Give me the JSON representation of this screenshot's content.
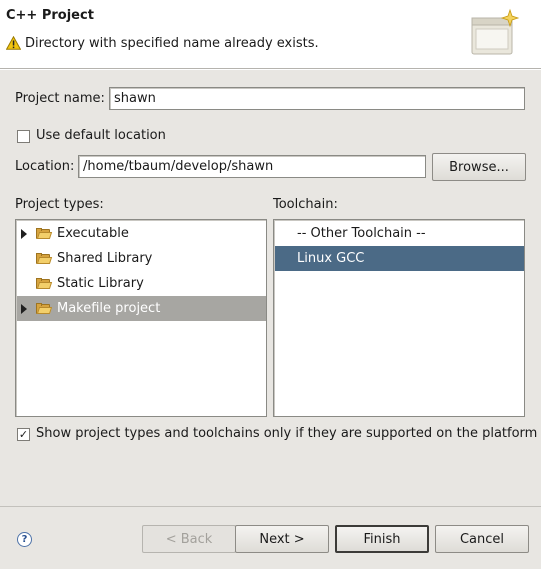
{
  "header": {
    "title": "C++ Project",
    "message": "Directory with specified name already exists."
  },
  "project_name": {
    "label": "Project name:",
    "value": "shawn"
  },
  "use_default_location": {
    "label": "Use default location",
    "checked": false
  },
  "location": {
    "label": "Location:",
    "value": "/home/tbaum/develop/shawn",
    "browse_label": "Browse..."
  },
  "project_types": {
    "label": "Project types:",
    "items": [
      {
        "label": "Executable",
        "expandable": true,
        "selected": false
      },
      {
        "label": "Shared Library",
        "expandable": false,
        "selected": false
      },
      {
        "label": "Static Library",
        "expandable": false,
        "selected": false
      },
      {
        "label": "Makefile project",
        "expandable": true,
        "selected": true
      }
    ]
  },
  "toolchain": {
    "label": "Toolchain:",
    "items": [
      {
        "label": "-- Other Toolchain --",
        "selected": false
      },
      {
        "label": "Linux GCC",
        "selected": true
      }
    ]
  },
  "show_supported": {
    "label": "Show project types and toolchains only if they are supported on the platform",
    "checked": true
  },
  "buttons": {
    "help": "?",
    "back": "< Back",
    "next": "Next >",
    "finish": "Finish",
    "cancel": "Cancel"
  },
  "colors": {
    "selection_focused": "#4b6a86",
    "selection_unfocused": "#a7a6a2"
  }
}
